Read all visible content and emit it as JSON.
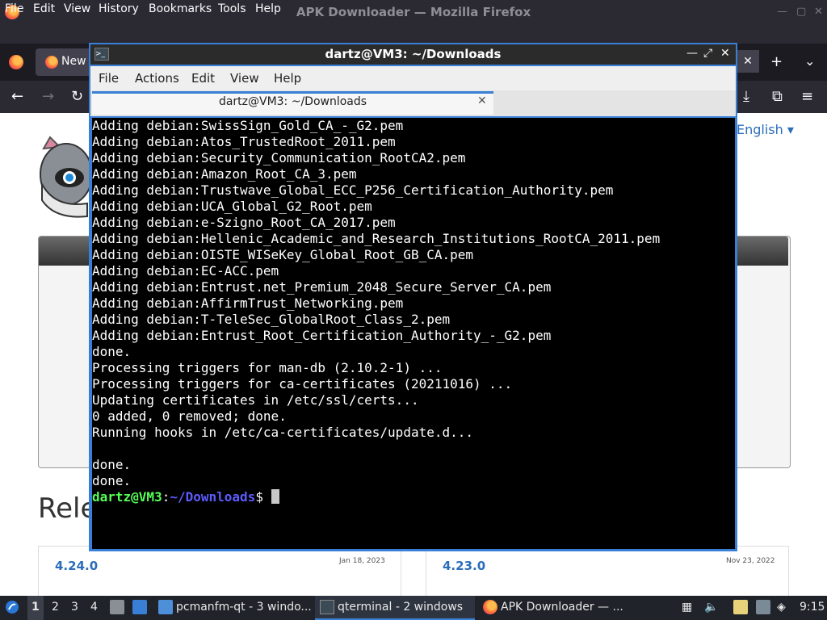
{
  "firefox": {
    "window_title": "APK Downloader — Mozilla Firefox",
    "menus": [
      "File",
      "Edit",
      "View",
      "History",
      "Bookmarks",
      "Tools",
      "Help"
    ],
    "tab_label": "New",
    "tab_close": "✕",
    "newtab": "+",
    "tablist": "⌄",
    "page": {
      "language": "English",
      "releases_heading": "Rele",
      "cards": [
        {
          "version": "4.24.0",
          "date": "Jan 18, 2023"
        },
        {
          "version": "4.23.0",
          "date": "Nov 23, 2022"
        }
      ]
    }
  },
  "terminal": {
    "window_title": "dartz@VM3: ~/Downloads",
    "menus": [
      "File",
      "Actions",
      "Edit",
      "View",
      "Help"
    ],
    "tab_title": "dartz@VM3: ~/Downloads",
    "tab_close": "✕",
    "lines": [
      "Adding debian:SwissSign_Gold_CA_-_G2.pem",
      "Adding debian:Atos_TrustedRoot_2011.pem",
      "Adding debian:Security_Communication_RootCA2.pem",
      "Adding debian:Amazon_Root_CA_3.pem",
      "Adding debian:Trustwave_Global_ECC_P256_Certification_Authority.pem",
      "Adding debian:UCA_Global_G2_Root.pem",
      "Adding debian:e-Szigno_Root_CA_2017.pem",
      "Adding debian:Hellenic_Academic_and_Research_Institutions_RootCA_2011.pem",
      "Adding debian:OISTE_WISeKey_Global_Root_GB_CA.pem",
      "Adding debian:EC-ACC.pem",
      "Adding debian:Entrust.net_Premium_2048_Secure_Server_CA.pem",
      "Adding debian:AffirmTrust_Networking.pem",
      "Adding debian:T-TeleSec_GlobalRoot_Class_2.pem",
      "Adding debian:Entrust_Root_Certification_Authority_-_G2.pem",
      "done.",
      "Processing triggers for man-db (2.10.2-1) ...",
      "Processing triggers for ca-certificates (20211016) ...",
      "Updating certificates in /etc/ssl/certs...",
      "0 added, 0 removed; done.",
      "Running hooks in /etc/ca-certificates/update.d...",
      "",
      "done.",
      "done."
    ],
    "prompt": {
      "user": "dartz@VM3",
      "sep": ":",
      "path": "~/Downloads",
      "symbol": "$ "
    }
  },
  "taskbar": {
    "desktops": [
      "1",
      "2",
      "3",
      "4"
    ],
    "tasks": [
      {
        "label": "pcmanfm-qt - 3 windo..."
      },
      {
        "label": "qterminal - 2 windows"
      },
      {
        "label": "APK Downloader — ..."
      }
    ],
    "clock": "9:15"
  }
}
